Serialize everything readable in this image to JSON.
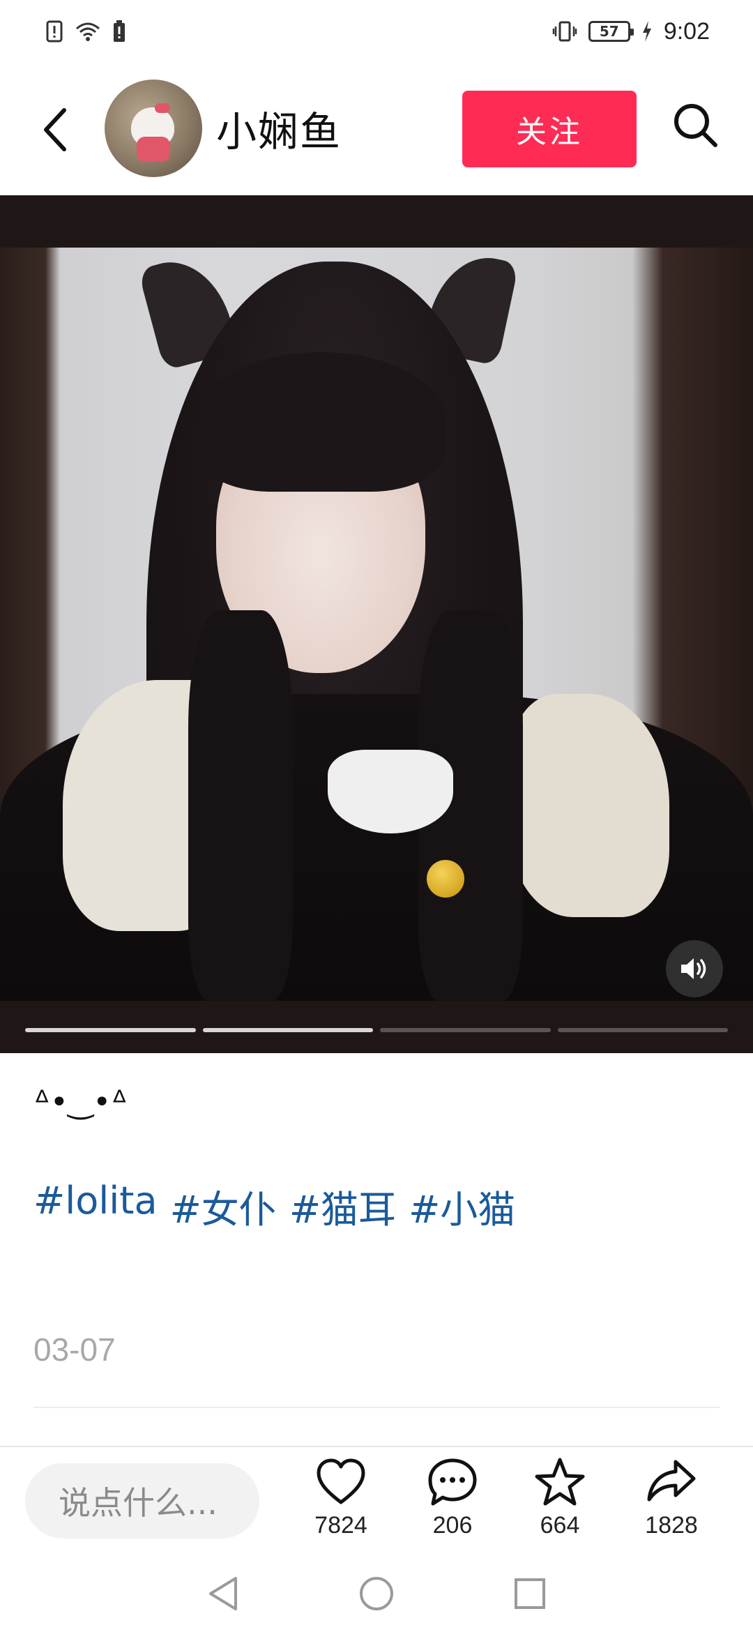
{
  "status_bar": {
    "battery_level": "57",
    "time": "9:02"
  },
  "header": {
    "username": "小娴鱼",
    "follow_label": "关注"
  },
  "media": {
    "slide_count": 4,
    "current_slide": 2
  },
  "post": {
    "emoticon": "ᐞ•‿•ᐞ",
    "tags": [
      "#lolita",
      "#女仆",
      "#猫耳",
      "#小猫"
    ],
    "date": "03-07"
  },
  "action_bar": {
    "comment_placeholder": "说点什么...",
    "likes": "7824",
    "comments": "206",
    "favorites": "664",
    "shares": "1828"
  },
  "colors": {
    "follow_button": "#fe2c55",
    "hashtag": "#1a5a9b",
    "date": "#a8a8a8"
  },
  "icons": {
    "back": "chevron-left-icon",
    "search": "search-icon",
    "sound": "speaker-icon",
    "like": "heart-icon",
    "comment": "chat-bubble-icon",
    "favorite": "star-icon",
    "share": "share-arrow-icon"
  }
}
